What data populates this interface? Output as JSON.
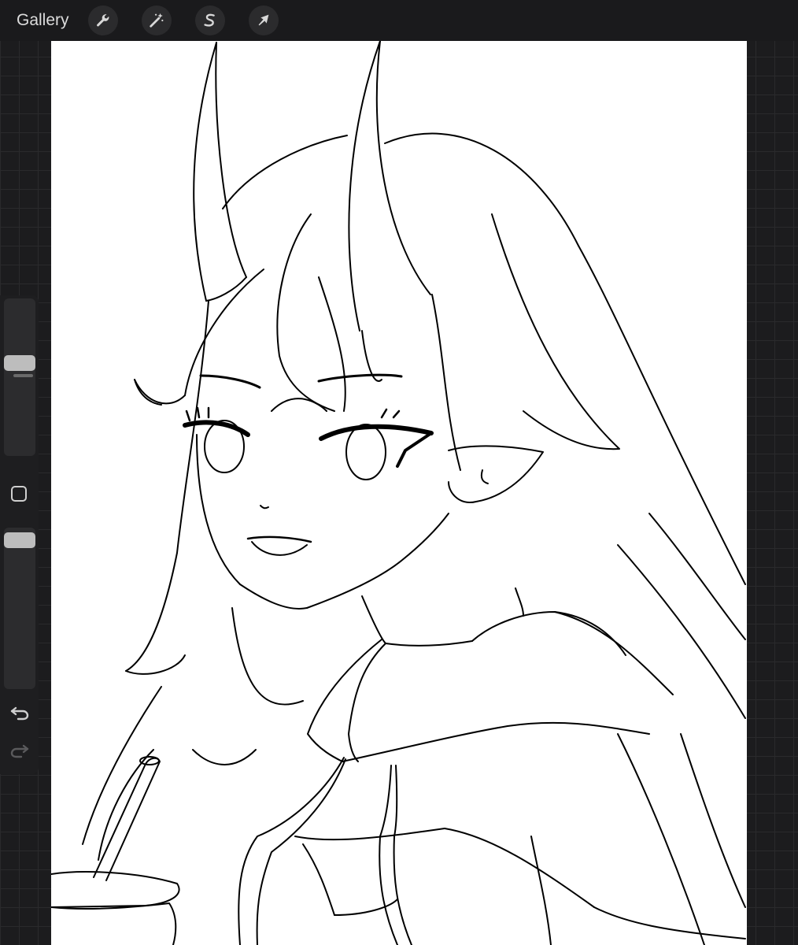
{
  "topbar": {
    "gallery_label": "Gallery",
    "tools": [
      {
        "name": "actions",
        "icon": "wrench-icon"
      },
      {
        "name": "adjustments",
        "icon": "magic-wand-icon"
      },
      {
        "name": "selection",
        "icon": "selection-s-icon"
      },
      {
        "name": "transform",
        "icon": "arrow-cursor-icon"
      }
    ]
  },
  "sidebar": {
    "brush_size_level": 0.6,
    "opacity_level": 0.97,
    "icons": [
      "modify-square-icon",
      "undo-icon",
      "redo-icon"
    ]
  },
  "colors": {
    "app_background": "#1c1c1e",
    "canvas": "#ffffff",
    "line_art": "#000000",
    "icon": "#d8d8d8"
  }
}
